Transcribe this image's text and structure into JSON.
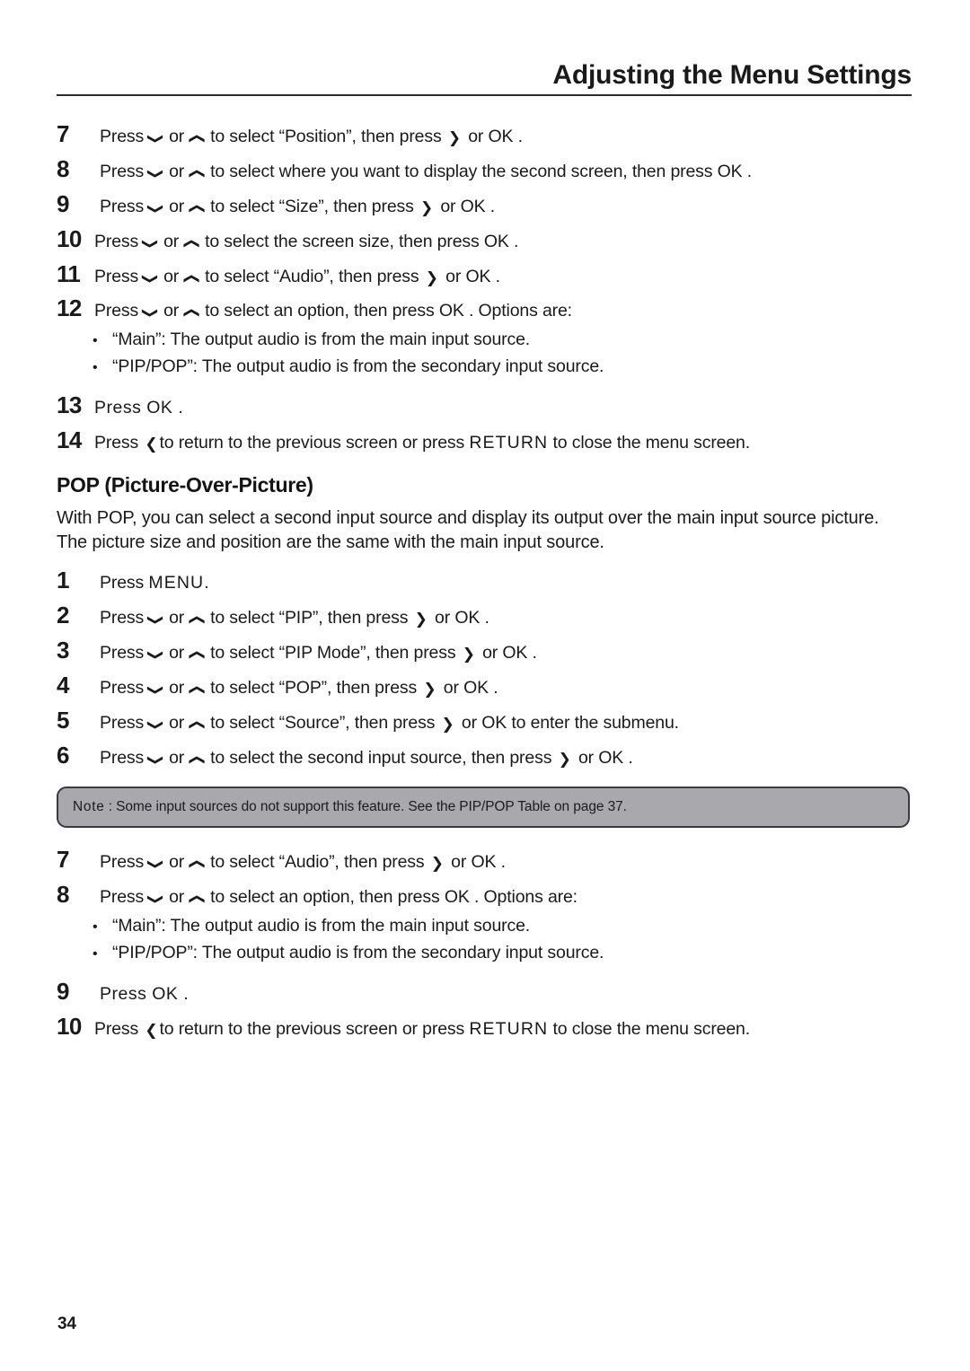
{
  "header": {
    "title": "Adjusting the Menu Settings"
  },
  "pip_steps": [
    {
      "num": "7",
      "parts": [
        "Press ",
        "down-chevron",
        " or ",
        "up-chevron",
        " to select “Position”, then press ",
        "right-chevron",
        " or OK ."
      ]
    },
    {
      "num": "8",
      "parts": [
        "Press ",
        "down-chevron",
        " or ",
        "up-chevron",
        " to select where you want to display the second screen, then press OK ."
      ]
    },
    {
      "num": "9",
      "parts": [
        "Press ",
        "down-chevron",
        " or ",
        "up-chevron",
        " to select “Size”, then press ",
        "right-chevron",
        " or OK ."
      ]
    },
    {
      "num": "10",
      "parts": [
        "Press ",
        "down-chevron",
        " or ",
        "up-chevron",
        " to select the screen size, then press OK ."
      ]
    },
    {
      "num": "11",
      "parts": [
        "Press ",
        "down-chevron",
        " or ",
        "up-chevron",
        " to select “Audio”, then press ",
        "right-chevron",
        " or OK ."
      ]
    },
    {
      "num": "12",
      "parts": [
        "Press ",
        "down-chevron",
        " or ",
        "up-chevron",
        " to select an option, then press OK . Options are:"
      ]
    }
  ],
  "pip_step7": {
    "num": "7",
    "pre": "Press ",
    "mid": " or ",
    "after_up": " to select “Position”, then press ",
    "tail": " or OK ."
  },
  "pip_step8": {
    "num": "8",
    "pre": "Press ",
    "mid": " or ",
    "after_up": " to select where you want to display the second screen, then press OK ."
  },
  "pip_step9": {
    "num": "9",
    "pre": "Press ",
    "mid": " or ",
    "after_up": " to select “Size”, then press ",
    "tail": " or OK ."
  },
  "pip_step10": {
    "num": "10",
    "pre": "Press ",
    "mid": " or ",
    "after_up": " to select the screen size, then press OK ."
  },
  "pip_step11": {
    "num": "11",
    "pre": "Press ",
    "mid": " or ",
    "after_up": " to select “Audio”, then press ",
    "tail": " or OK ."
  },
  "pip_step12": {
    "num": "12",
    "pre": "Press ",
    "mid": " or ",
    "after_up": " to select an option, then press OK . Options are:"
  },
  "pip_bullets": [
    "“Main”: The output audio is from the main input source.",
    "“PIP/POP”: The output audio is from the secondary input source."
  ],
  "pip_bullet1": "“Main”: The output audio is from the main input source.",
  "pip_bullet2": "“PIP/POP”: The output audio is from the secondary input source.",
  "bullet_marker": "•",
  "pip_step13": {
    "num": "13",
    "text": "Press OK ."
  },
  "pip_step14": {
    "num": "14",
    "pre": "Press ",
    "mid": "to return to the previous screen or press ",
    "key": "RETURN",
    "tail": " to close the menu screen."
  },
  "pop_section": {
    "heading": "POP (Picture-Over-Picture)",
    "paragraph": "With POP, you can select a second input source and display its output over the main input source picture. The picture size and position are the same with the main input source."
  },
  "pop_step1": {
    "num": "1",
    "pre": "Press ",
    "key": "MENU",
    "tail": "."
  },
  "pop_step2": {
    "num": "2",
    "pre": "Press ",
    "mid": " or ",
    "after_up": " to select “PIP”, then press ",
    "tail": " or OK ."
  },
  "pop_step3": {
    "num": "3",
    "pre": "Press ",
    "mid": " or ",
    "after_up": " to select “PIP Mode”, then press ",
    "tail": " or OK ."
  },
  "pop_step4": {
    "num": "4",
    "pre": "Press ",
    "mid": " or ",
    "after_up": " to select “POP”, then press ",
    "tail": " or OK ."
  },
  "pop_step5": {
    "num": "5",
    "pre": "Press ",
    "mid": " or ",
    "after_up": " to select “Source”, then press ",
    "tail": " or OK  to enter the submenu."
  },
  "pop_step6": {
    "num": "6",
    "pre": "Press ",
    "mid": " or ",
    "after_up": " to select the second input source, then press ",
    "tail": " or OK ."
  },
  "note": {
    "label": "Note",
    "separator": " : ",
    "text": "Some input sources do not support this feature. See the PIP/POP Table on page 37.",
    "background_color": "#a9a9ad",
    "border_color": "#3a3a3e"
  },
  "pop_step7": {
    "num": "7",
    "pre": "Press ",
    "mid": " or ",
    "after_up": " to select “Audio”, then press ",
    "tail": " or OK ."
  },
  "pop_step8": {
    "num": "8",
    "pre": "Press ",
    "mid": " or ",
    "after_up": " to select an option, then press OK . Options are:"
  },
  "pop_bullet1": "“Main”: The output audio is from the main input source.",
  "pop_bullet2": "“PIP/POP”: The output audio is from the secondary input source.",
  "pop_step9": {
    "num": "9",
    "text": "Press OK ."
  },
  "pop_step10": {
    "num": "10",
    "pre": "Press ",
    "mid": "to return to the previous screen or press ",
    "key": "RETURN",
    "tail": " to close the menu screen."
  },
  "icons": {
    "down": "❯",
    "up": "❯",
    "right": "❯",
    "left": "❮"
  },
  "footer": {
    "page_number": "34"
  }
}
